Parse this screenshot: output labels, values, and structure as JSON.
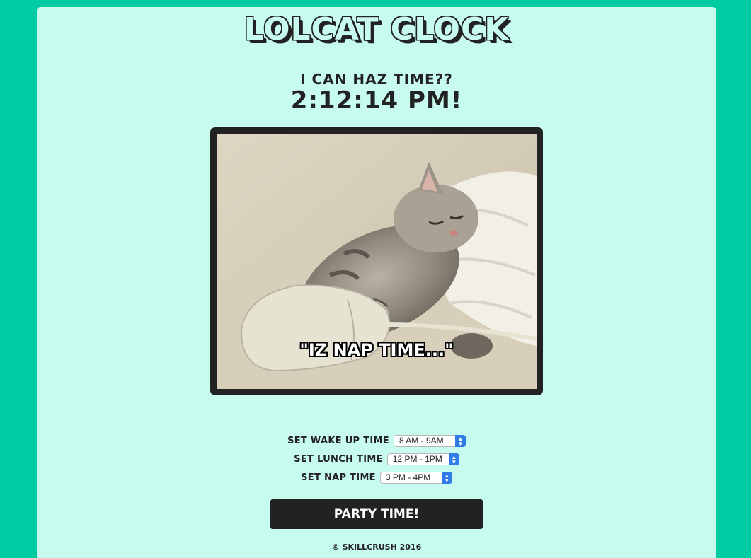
{
  "header": {
    "title": "LOLCAT CLOCK",
    "subtitle": "I CAN HAZ TIME??",
    "time": "2:12:14 PM!"
  },
  "photo": {
    "caption": "\"IZ NAP TIME...\"",
    "icon": "sleeping-kitten-photo"
  },
  "controls": {
    "wake_label": "SET WAKE UP TIME",
    "wake_value": "8 AM - 9AM",
    "lunch_label": "SET LUNCH TIME",
    "lunch_value": "12 PM - 1PM",
    "nap_label": "SET NAP TIME",
    "nap_value": "3 PM - 4PM"
  },
  "button": {
    "label": "PARTY TIME!"
  },
  "footer": {
    "copyright": "© SKILLCRUSH 2016"
  },
  "colors": {
    "background": "#00cca3",
    "card": "#c8fbef",
    "dark": "#222222",
    "select_accent": "#2f7be8"
  }
}
